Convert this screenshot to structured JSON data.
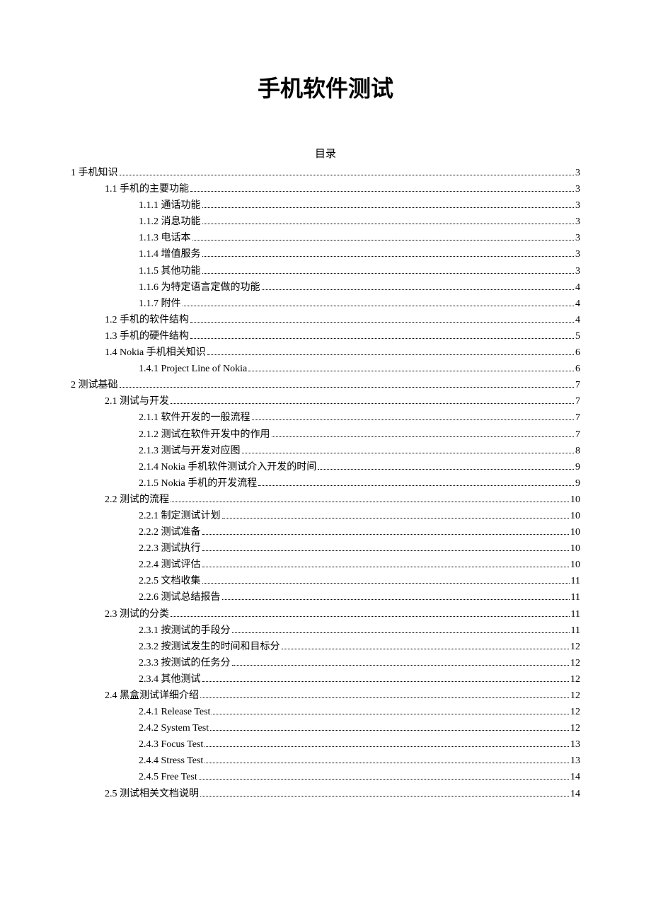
{
  "title": "手机软件测试",
  "toc_heading": "目录",
  "toc": [
    {
      "level": 1,
      "label": "1 手机知识",
      "page": "3"
    },
    {
      "level": 2,
      "label": "1.1 手机的主要功能",
      "page": "3"
    },
    {
      "level": 3,
      "label": "1.1.1 通话功能",
      "page": "3"
    },
    {
      "level": 3,
      "label": "1.1.2 消息功能",
      "page": "3"
    },
    {
      "level": 3,
      "label": "1.1.3 电话本",
      "page": "3"
    },
    {
      "level": 3,
      "label": "1.1.4 增值服务",
      "page": "3"
    },
    {
      "level": 3,
      "label": "1.1.5 其他功能",
      "page": "3"
    },
    {
      "level": 3,
      "label": "1.1.6 为特定语言定做的功能",
      "page": "4"
    },
    {
      "level": 3,
      "label": "1.1.7 附件",
      "page": "4"
    },
    {
      "level": 2,
      "label": "1.2 手机的软件结构",
      "page": "4"
    },
    {
      "level": 2,
      "label": "1.3 手机的硬件结构",
      "page": "5"
    },
    {
      "level": 2,
      "label": "1.4 Nokia 手机相关知识",
      "page": "6"
    },
    {
      "level": 3,
      "label": "1.4.1 Project Line of Nokia",
      "page": "6"
    },
    {
      "level": 1,
      "label": "2 测试基础",
      "page": "7"
    },
    {
      "level": 2,
      "label": "2.1 测试与开发",
      "page": "7"
    },
    {
      "level": 3,
      "label": "2.1.1 软件开发的一般流程",
      "page": "7"
    },
    {
      "level": 3,
      "label": "2.1.2 测试在软件开发中的作用",
      "page": "7"
    },
    {
      "level": 3,
      "label": "2.1.3 测试与开发对应图",
      "page": "8"
    },
    {
      "level": 3,
      "label": "2.1.4 Nokia 手机软件测试介入开发的时间",
      "page": "9"
    },
    {
      "level": 3,
      "label": "2.1.5 Nokia 手机的开发流程",
      "page": "9"
    },
    {
      "level": 2,
      "label": "2.2 测试的流程",
      "page": "10"
    },
    {
      "level": 3,
      "label": "2.2.1 制定测试计划",
      "page": "10"
    },
    {
      "level": 3,
      "label": "2.2.2 测试准备",
      "page": "10"
    },
    {
      "level": 3,
      "label": "2.2.3 测试执行",
      "page": "10"
    },
    {
      "level": 3,
      "label": "2.2.4 测试评估",
      "page": "10"
    },
    {
      "level": 3,
      "label": "2.2.5 文档收集",
      "page": "11"
    },
    {
      "level": 3,
      "label": "2.2.6 测试总结报告",
      "page": "11"
    },
    {
      "level": 2,
      "label": "2.3 测试的分类",
      "page": "11"
    },
    {
      "level": 3,
      "label": "2.3.1 按测试的手段分",
      "page": "11"
    },
    {
      "level": 3,
      "label": "2.3.2 按测试发生的时间和目标分",
      "page": "12"
    },
    {
      "level": 3,
      "label": "2.3.3 按测试的任务分",
      "page": "12"
    },
    {
      "level": 3,
      "label": "2.3.4 其他测试",
      "page": "12"
    },
    {
      "level": 2,
      "label": "2.4 黑盒测试详细介绍",
      "page": "12"
    },
    {
      "level": 3,
      "label": "2.4.1 Release Test",
      "page": "12"
    },
    {
      "level": 3,
      "label": "2.4.2 System Test",
      "page": "12"
    },
    {
      "level": 3,
      "label": "2.4.3 Focus Test",
      "page": "13"
    },
    {
      "level": 3,
      "label": "2.4.4 Stress Test",
      "page": "13"
    },
    {
      "level": 3,
      "label": "2.4.5 Free Test",
      "page": "14"
    },
    {
      "level": 2,
      "label": "2.5 测试相关文档说明",
      "page": "14"
    }
  ]
}
